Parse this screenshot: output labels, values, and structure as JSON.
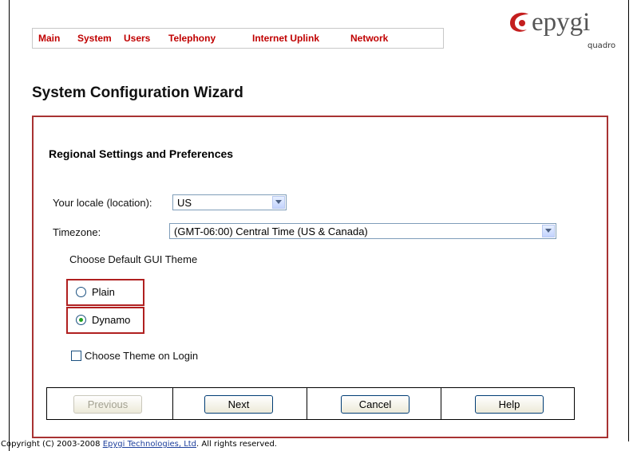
{
  "menu": {
    "items": [
      "Main",
      "System",
      "Users",
      "Telephony",
      "Internet Uplink",
      "Network"
    ]
  },
  "logo": {
    "word": "epygi",
    "sub": "quadro"
  },
  "page_title": "System Configuration Wizard",
  "section_title": "Regional Settings and Preferences",
  "locale": {
    "label": "Your locale (location):",
    "value": "US"
  },
  "timezone": {
    "label": "Timezone:",
    "value": "(GMT-06:00) Central Time (US & Canada)"
  },
  "theme": {
    "heading": "Choose Default GUI Theme",
    "options": [
      {
        "label": "Plain",
        "selected": false
      },
      {
        "label": "Dynamo",
        "selected": true
      }
    ],
    "choose_on_login_label": "Choose Theme on Login",
    "choose_on_login_checked": false
  },
  "buttons": {
    "previous": "Previous",
    "next": "Next",
    "cancel": "Cancel",
    "help": "Help"
  },
  "footer": {
    "prefix": "Copyright (C) 2003-2008 ",
    "company": "Epygi Technologies, Ltd",
    "suffix": ". All rights reserved."
  },
  "colors": {
    "menu_text": "#c00000",
    "panel_border": "#a83232",
    "theme_box_border": "#b02020"
  }
}
